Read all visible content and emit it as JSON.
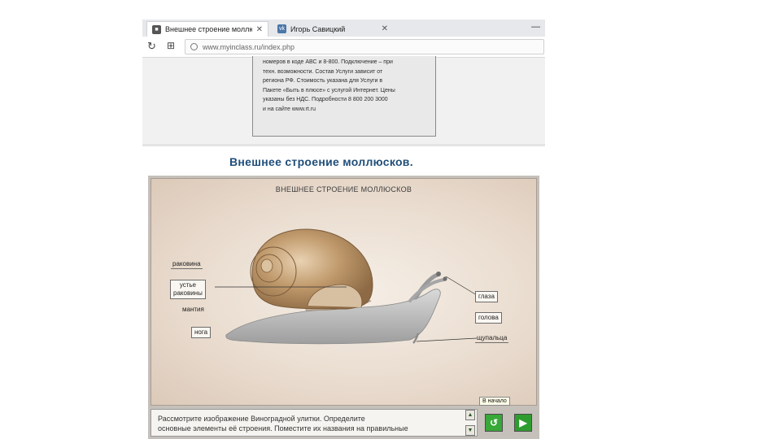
{
  "browser": {
    "tabs": [
      {
        "label": "Внешнее строение моллю",
        "favicon": "page-favicon",
        "close": "✕"
      },
      {
        "label": "Игорь Савицкий",
        "favicon": "vk-favicon",
        "close": "✕"
      }
    ],
    "window_minimize": "—",
    "url": "www.myinclass.ru/index.php"
  },
  "ad_text": [
    "номеров в коде АВС и 8-800. Подключение – при",
    "техн. возможности. Состав Услуги зависит от",
    "региона РФ. Стоимость указана для Услуги в",
    "Пакете «Быть в плюсе» с услугой Интернет. Цены",
    "указаны без НДС. Подробности 8 800 200 3000",
    "и на сайте www.rt.ru"
  ],
  "slide_title": "Внешнее строение моллюсков.",
  "scene": {
    "title": "ВНЕШНЕЕ СТРОЕНИЕ МОЛЛЮСКОВ",
    "labels": {
      "shell": "раковина",
      "mouth_1": "устье",
      "mouth_2": "раковины",
      "mantle": "мантия",
      "foot": "нога",
      "eyes": "глаза",
      "head": "голова",
      "tentacles": "щупальца"
    }
  },
  "instructions": [
    "Рассмотрите изображение Виноградной улитки. Определите",
    "основные элементы её строения. Поместите их названия на правильные"
  ],
  "controls": {
    "tooltip": "В начало",
    "scroll_up": "▲",
    "scroll_down": "▼",
    "home_icon": "↺",
    "next_icon": "▶"
  },
  "colors": {
    "title_blue": "#1f4e79",
    "button_green": "#38a838",
    "shell_brown": "#b08a5e",
    "body_gray": "#b9b9b9"
  }
}
